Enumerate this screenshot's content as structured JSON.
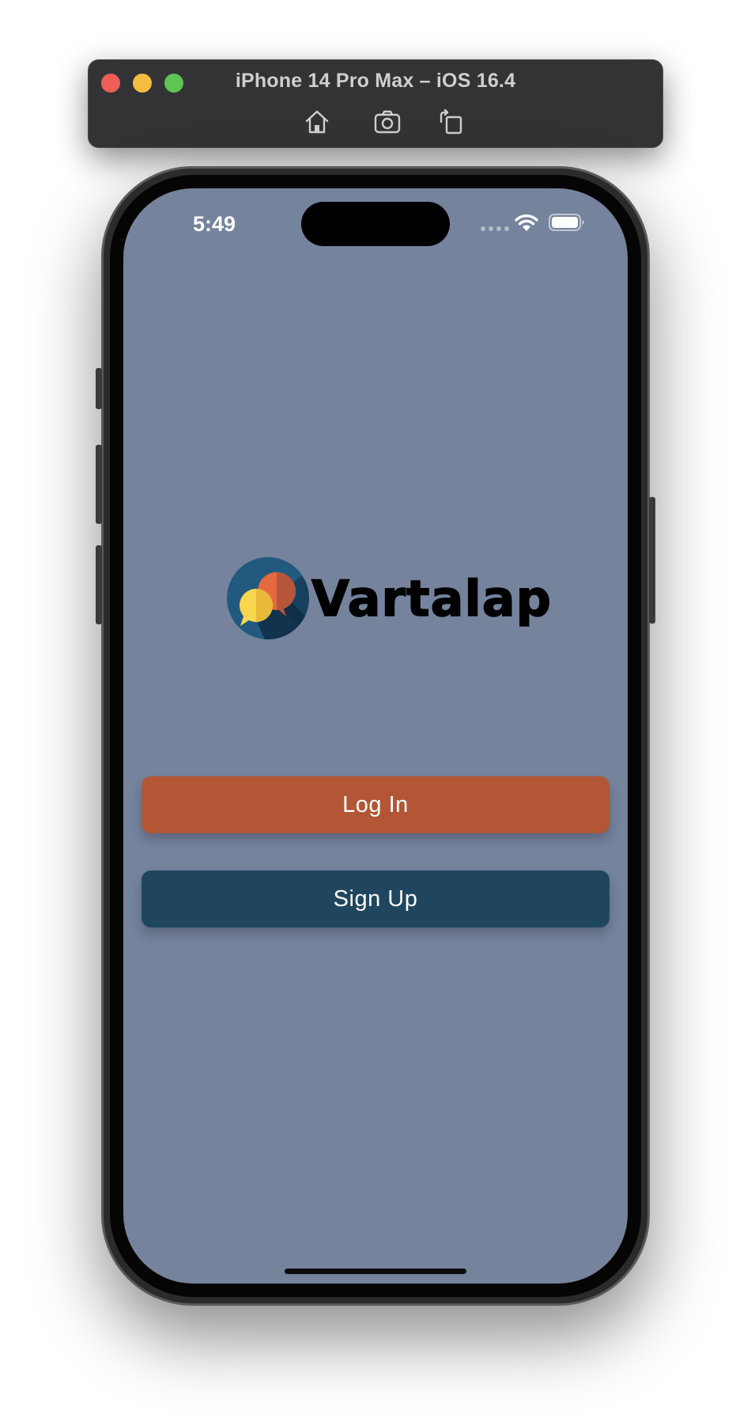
{
  "simulator": {
    "title": "iPhone 14 Pro Max – iOS 16.4",
    "toolbar_icons": [
      "home-icon",
      "screenshot-icon",
      "rotate-icon"
    ]
  },
  "status_bar": {
    "time": "5:49",
    "icons": [
      "cellular-signal-icon",
      "wifi-icon",
      "battery-icon"
    ]
  },
  "app": {
    "logo_text": "Vartalap",
    "login_label": "Log In",
    "signup_label": "Sign Up"
  },
  "colors": {
    "screen_background": "#75839d",
    "login_button": "#b25636",
    "signup_button": "#1f465e",
    "logo_circle": "#215a7e",
    "bubble_orange": "#e4693f",
    "bubble_yellow": "#f8d64e"
  }
}
